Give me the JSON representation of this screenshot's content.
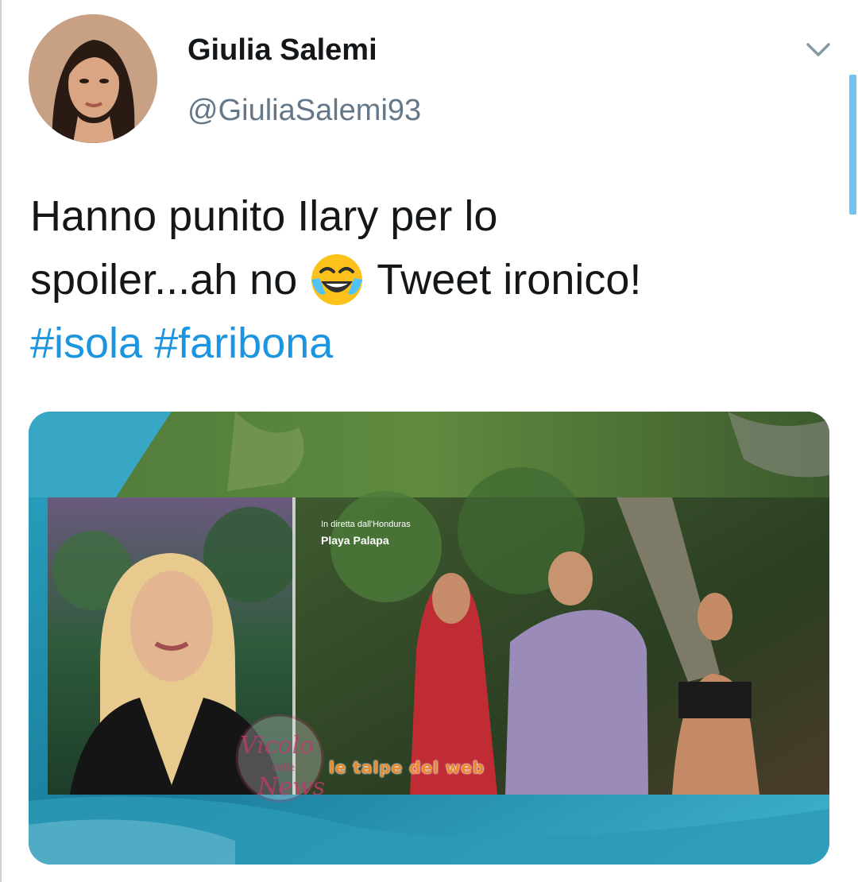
{
  "tweet": {
    "display_name": "Giulia Salemi",
    "handle": "@GiuliaSalemi93",
    "text_line1": "Hanno punito Ilary per lo",
    "text_line2_before": "spoiler...ah no",
    "text_line2_after": "Tweet ironico!",
    "emoji": "face-with-tears-of-joy",
    "hashtags": [
      "#isola",
      "#faribona"
    ]
  },
  "media": {
    "caption_line1": "In diretta dall'Honduras",
    "caption_line2": "Playa Palapa",
    "watermark_1": "Vicolo delle News",
    "watermark_2": "le talpe del web"
  },
  "colors": {
    "text": "#14171a",
    "secondary": "#657786",
    "link": "#1b95e0",
    "scroll_indicator": "#6fc3ee"
  },
  "icons": {
    "menu": "chevron-down-icon"
  }
}
